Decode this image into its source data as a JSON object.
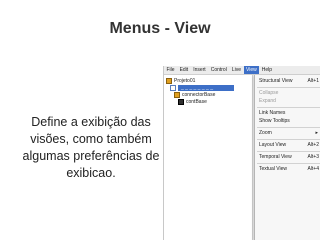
{
  "slide": {
    "title": "Menus - View",
    "caption": "Define a exibição das visões, como também algumas preferências de exibicao."
  },
  "app": {
    "menubar": [
      "File",
      "Edit",
      "Insert",
      "Control",
      "Live",
      "View",
      "Help"
    ],
    "active_menu": "View",
    "tree": {
      "items": [
        {
          "label": "Projeto01",
          "icon": "project-icon"
        },
        {
          "label": "_ _ _ _ _ _ _ _",
          "icon": "document-icon"
        },
        {
          "label": "connectorBase",
          "icon": "folder-icon"
        },
        {
          "label": "contBase",
          "icon": "file-icon"
        }
      ]
    },
    "view_menu": [
      {
        "label": "Structural View",
        "shortcut": "Alt+1",
        "enabled": true
      },
      {
        "label": "Collapse",
        "shortcut": "",
        "enabled": false
      },
      {
        "label": "Expand",
        "shortcut": "",
        "enabled": false
      },
      {
        "label": "Link Names",
        "shortcut": "",
        "enabled": true
      },
      {
        "label": "Show Tooltips",
        "shortcut": "",
        "enabled": true
      },
      {
        "label": "Zoom",
        "shortcut": "",
        "enabled": true,
        "submenu": true
      },
      {
        "label": "Layout View",
        "shortcut": "Alt+2",
        "enabled": true
      },
      {
        "label": "Temporal View",
        "shortcut": "Alt+3",
        "enabled": true
      },
      {
        "label": "Textual View",
        "shortcut": "Alt+4",
        "enabled": true
      }
    ],
    "submenu_glyph": "▸"
  }
}
